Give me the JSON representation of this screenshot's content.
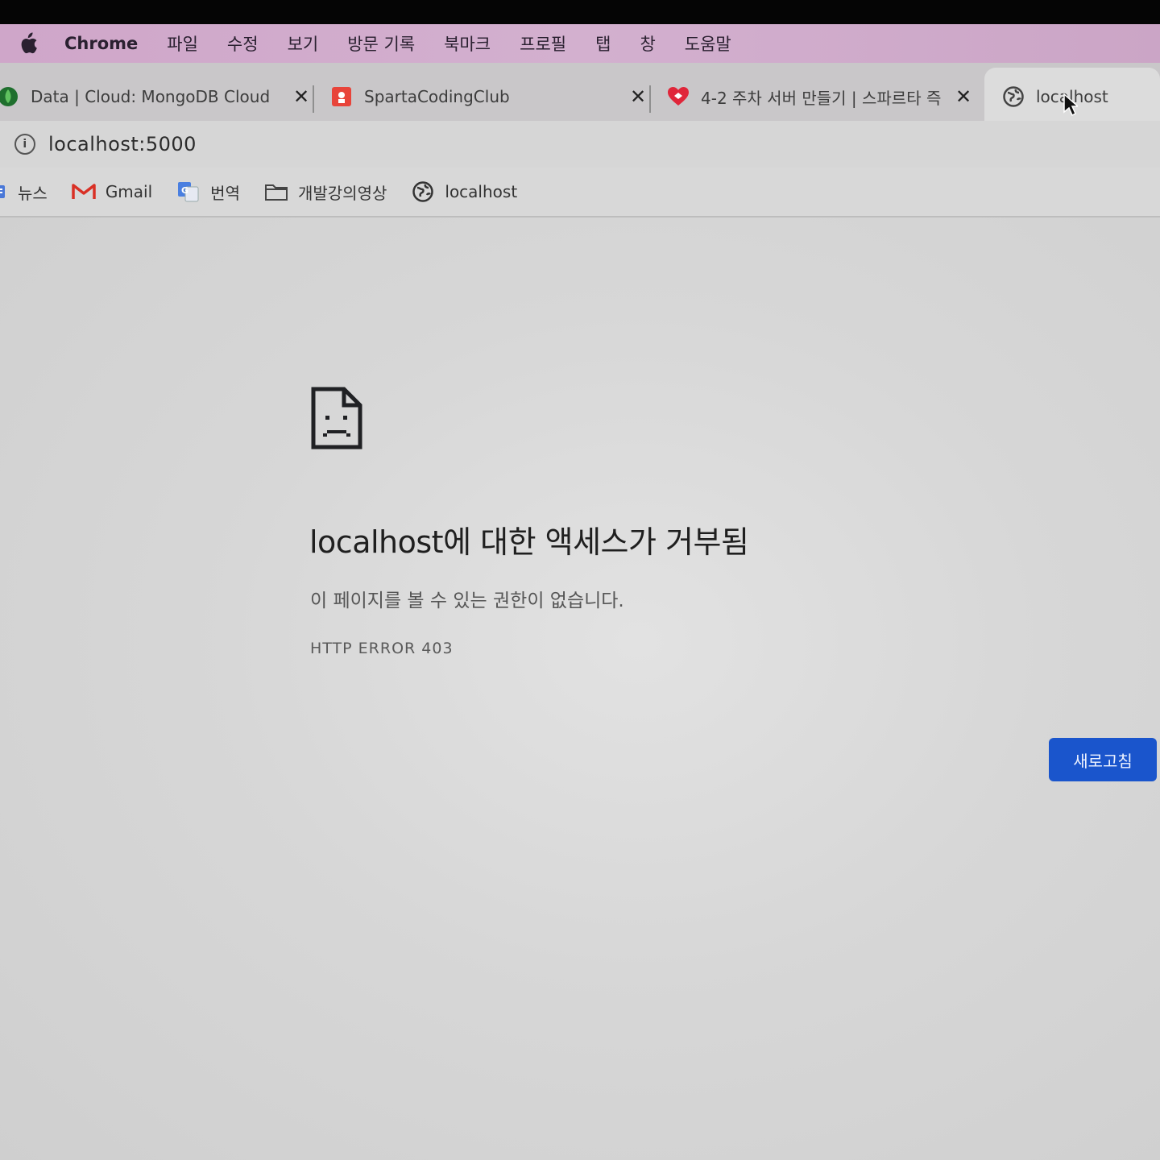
{
  "menubar": {
    "app": "Chrome",
    "items": [
      "파일",
      "수정",
      "보기",
      "방문 기록",
      "북마크",
      "프로필",
      "탭",
      "창",
      "도움말"
    ]
  },
  "tabs": [
    {
      "title": "Data | Cloud: MongoDB Cloud",
      "icon": "mongodb-leaf-icon",
      "close": "✕"
    },
    {
      "title": "SpartaCodingClub",
      "icon": "sparta-logo-icon",
      "close": "✕"
    },
    {
      "title": "4-2 주차 서버 만들기 | 스파르타 즉",
      "icon": "heart-logo-icon",
      "close": "✕"
    },
    {
      "title": "localhost",
      "icon": "globe-icon"
    }
  ],
  "address": {
    "url": "localhost:5000"
  },
  "bookmarks": [
    {
      "label": "뉴스",
      "icon": "news-icon"
    },
    {
      "label": "Gmail",
      "icon": "gmail-icon"
    },
    {
      "label": "번역",
      "icon": "translate-icon"
    },
    {
      "label": "개발강의영상",
      "icon": "folder-icon"
    },
    {
      "label": "localhost",
      "icon": "globe-icon"
    }
  ],
  "error": {
    "title": "localhost에 대한 액세스가 거부됨",
    "description": "이 페이지를 볼 수 있는 권한이 없습니다.",
    "code": "HTTP ERROR 403",
    "reload_label": "새로고침"
  },
  "colors": {
    "accent": "#1a55cc",
    "menubar": "#d3b0cf"
  }
}
